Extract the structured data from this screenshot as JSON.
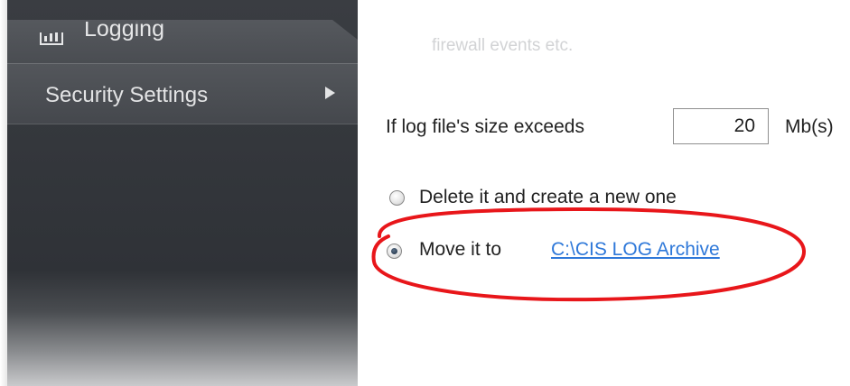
{
  "sidebar": {
    "items": [
      {
        "label": "Logging",
        "icon": "bar-chart-icon"
      },
      {
        "label": "Security Settings",
        "icon": "arrow-right-icon"
      }
    ]
  },
  "main": {
    "description_fragment": "firewall events etc.",
    "size_setting": {
      "label": "If log file's size exceeds",
      "value": "20",
      "unit": "Mb(s)"
    },
    "options": [
      {
        "label": "Delete it and create a new one",
        "checked": false
      },
      {
        "label": "Move it to",
        "checked": true,
        "link_text": "C:\\CIS LOG Archive"
      }
    ]
  },
  "colors": {
    "sidebar_bg": "#34373c",
    "link": "#2e78d9",
    "highlight_ellipse": "#e8161a"
  }
}
